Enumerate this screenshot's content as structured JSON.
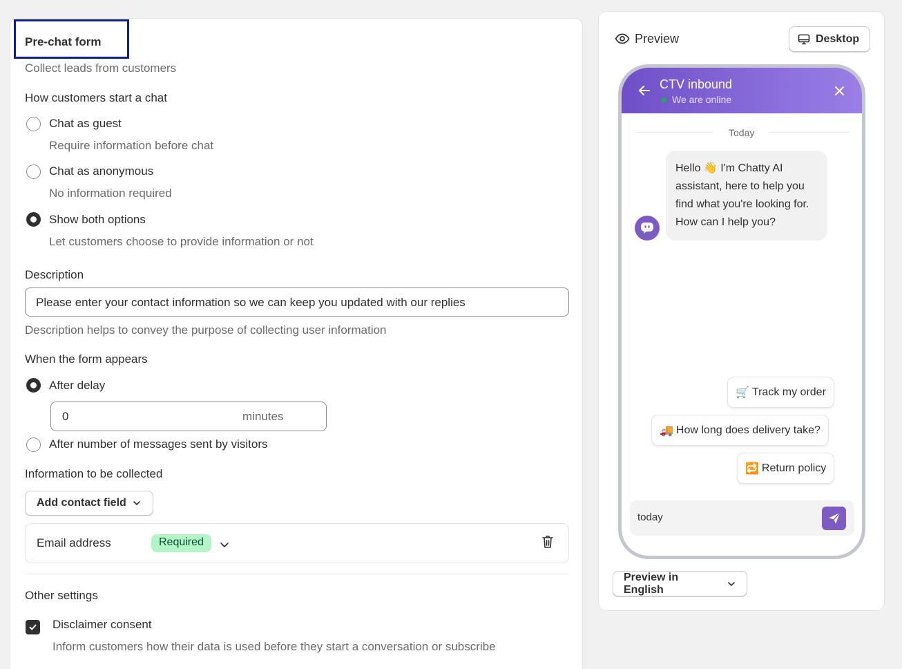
{
  "form": {
    "title": "Pre-chat form",
    "subtitle": "Collect leads from customers",
    "start_heading": "How customers start a chat",
    "start_options": [
      {
        "label": "Chat as guest",
        "help": "Require information before chat",
        "selected": false
      },
      {
        "label": "Chat as anonymous",
        "help": "No information required",
        "selected": false
      },
      {
        "label": "Show both options",
        "help": "Let customers choose to provide information or not",
        "selected": true
      }
    ],
    "description_label": "Description",
    "description_value": "Please enter your contact information so we can keep you updated with our replies",
    "description_help": "Description helps to convey the purpose of collecting user information",
    "appear_heading": "When the form appears",
    "appear_options": [
      {
        "label": "After delay",
        "selected": true
      },
      {
        "label": "After number of messages sent by visitors",
        "selected": false
      }
    ],
    "delay_value": "0",
    "delay_unit": "minutes",
    "collect_heading": "Information to be collected",
    "add_field_label": "Add contact field",
    "fields": [
      {
        "label": "Email address",
        "badge": "Required"
      }
    ],
    "other_heading": "Other settings",
    "disclaimer_label": "Disclaimer consent",
    "disclaimer_help": "Inform customers how their data is used before they start a conversation or subscribe",
    "disclaimer_checked": true
  },
  "preview": {
    "title": "Preview",
    "device_label": "Desktop",
    "chat_title": "CTV inbound",
    "chat_status": "We are online",
    "date_divider": "Today",
    "bot_message": "Hello 👋 I'm Chatty AI assistant, here to help you find what you're looking for. How can I help you?",
    "quick_replies": [
      {
        "emoji": "🛒",
        "label": "Track my order"
      },
      {
        "emoji": "🚚",
        "label": "How long does delivery take?"
      },
      {
        "emoji": "🔁",
        "label": "Return policy"
      }
    ],
    "composer_value": "today",
    "language_button": "Preview in English",
    "accent_color": "#7c5cc4",
    "online_color": "#29a36a"
  }
}
